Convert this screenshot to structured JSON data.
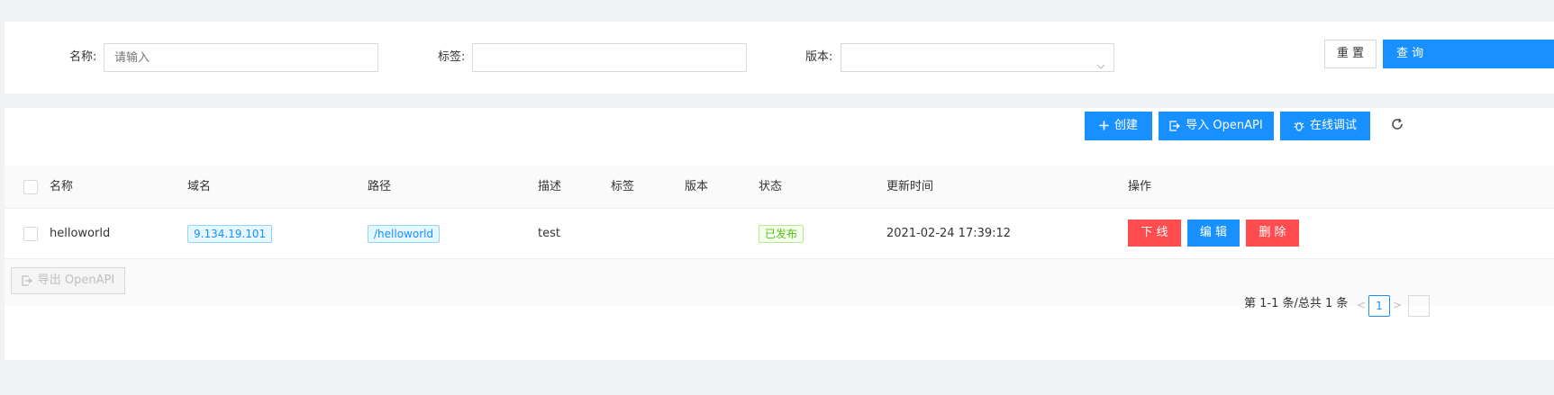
{
  "filters": {
    "name_label": "名称:",
    "name_placeholder": "请输入",
    "tag_label": "标签:",
    "version_label": "版本:",
    "reset_label": "重 置",
    "query_label": "查 询"
  },
  "toolbar": {
    "create_label": "创建",
    "import_label": "导入 OpenAPI",
    "debug_label": "在线调试"
  },
  "table": {
    "columns": [
      "名称",
      "域名",
      "路径",
      "描述",
      "标签",
      "版本",
      "状态",
      "更新时间",
      "操作"
    ],
    "rows": [
      {
        "name": "helloworld",
        "domain": "9.134.19.101",
        "path": "/helloworld",
        "description": "test",
        "tag": "",
        "version": "",
        "status": "已发布",
        "updated": "2021-02-24 17:39:12",
        "actions": [
          "下 线",
          "编 辑",
          "删 除"
        ]
      }
    ]
  },
  "footer": {
    "export_label": "导出 OpenAPI"
  },
  "pagination": {
    "summary": "第 1-1 条/总共 1 条",
    "current_page": "1"
  },
  "colors": {
    "primary": "#1890ff",
    "danger": "#ff4d4f",
    "success": "#52c41a"
  }
}
